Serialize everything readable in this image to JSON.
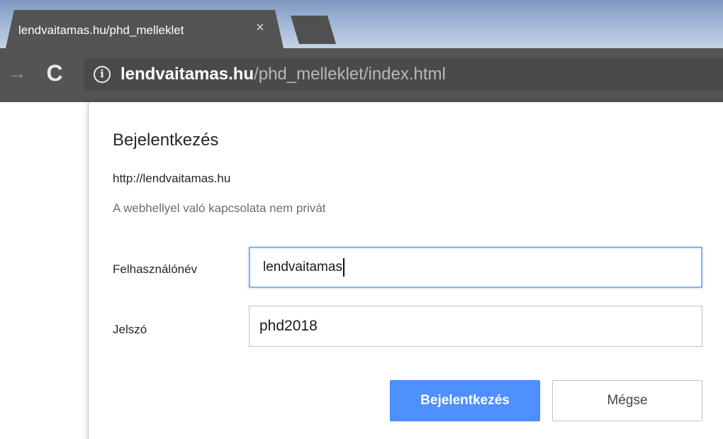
{
  "browser": {
    "tab": {
      "title": "lendvaitamas.hu/phd_melleklet",
      "close_icon": "×"
    },
    "toolbar": {
      "forward_icon": "→",
      "reload_icon": "C",
      "info_icon": "i",
      "url_host": "lendvaitamas.hu",
      "url_path": "/phd_melleklet/index.html"
    }
  },
  "dialog": {
    "title": "Bejelentkezés",
    "origin": "http://lendvaitamas.hu",
    "warning": "A webhellyel való kapcsolata nem privát",
    "username": {
      "label": "Felhasználónév",
      "value": "lendvaitamas"
    },
    "password": {
      "label": "Jelszó",
      "value": "phd2018"
    },
    "buttons": {
      "login": "Bejelentkezés",
      "cancel": "Mégse"
    }
  },
  "colors": {
    "primary_button": "#4d90fe",
    "tab_dark": "#545454",
    "tabstrip_blue": "#a6bbd9"
  }
}
